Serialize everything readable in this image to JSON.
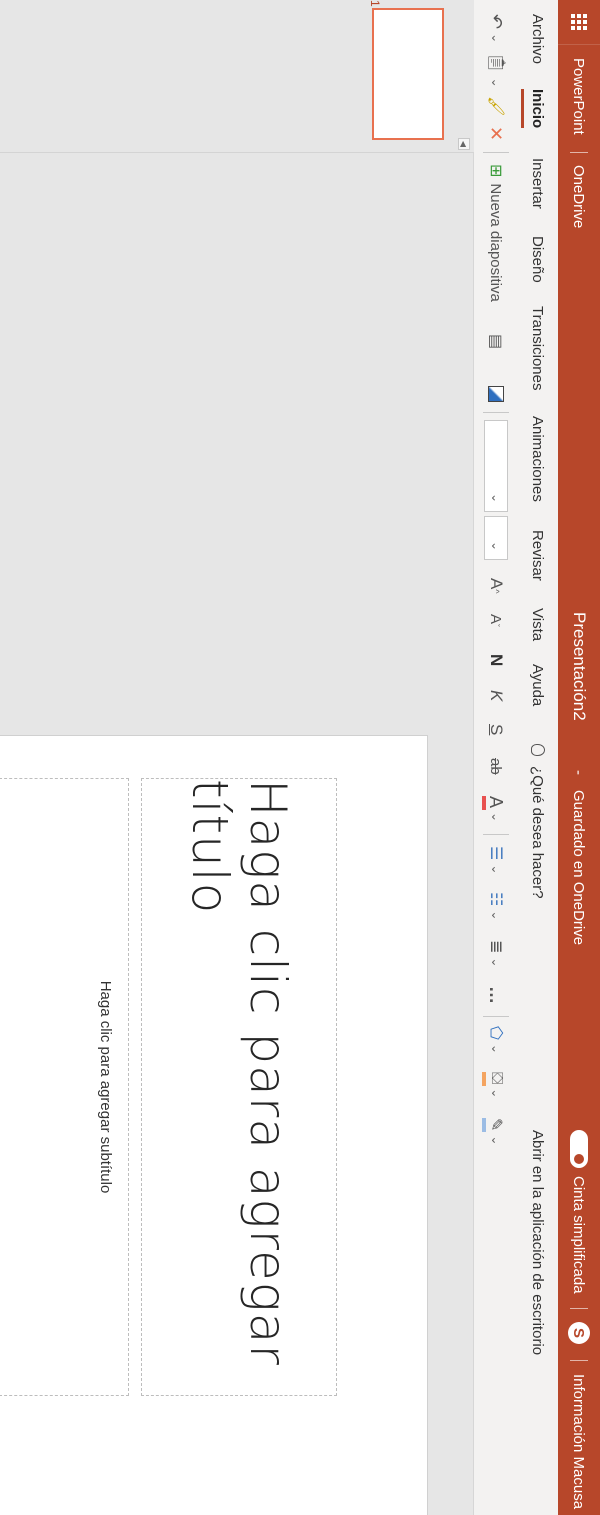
{
  "titlebar": {
    "app_name": "PowerPoint",
    "cloud": "OneDrive",
    "doc_title": "Presentación2",
    "dash": "-",
    "save_status": "Guardado en OneDrive",
    "simplified_ribbon": "Cinta simplificada",
    "skype_letter": "S",
    "account": "Información Macusa",
    "accent_color": "#b7472a"
  },
  "tabs": [
    {
      "label": "Archivo"
    },
    {
      "label": "Inicio",
      "active": true
    },
    {
      "label": "Insertar"
    },
    {
      "label": "Diseño"
    },
    {
      "label": "Transiciones"
    },
    {
      "label": "Animaciones"
    },
    {
      "label": "Revisar"
    },
    {
      "label": "Vista"
    },
    {
      "label": "Ayuda"
    }
  ],
  "search_placeholder": "¿Qué desea hacer?",
  "open_desktop": "Abrir en la aplicación de escritorio",
  "toolbar": {
    "new_slide": "Nueva diapositiva",
    "bold": "N",
    "italic": "K",
    "underline": "S",
    "strike": "ab",
    "font_color_glyph": "A",
    "grow_font": "A",
    "shrink_font": "A",
    "more": "…",
    "font_color": "#e8514f",
    "highlight_color": "#f4a460",
    "pen_color": "#9bbce4"
  },
  "thumbnails": {
    "slide_number": "1"
  },
  "slide": {
    "title_placeholder": "Haga clic para agregar título",
    "subtitle_placeholder": "Haga clic para agregar subtítulo"
  }
}
